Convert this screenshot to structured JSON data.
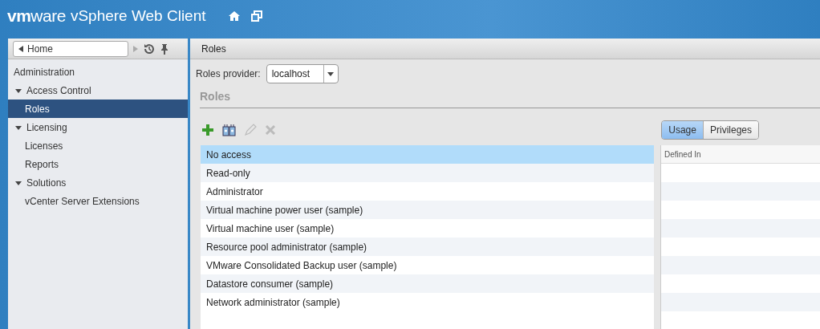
{
  "header": {
    "logo": "**vm**ware",
    "title": "vSphere Web Client"
  },
  "nav": {
    "back_label": "Home"
  },
  "sidebar": {
    "heading": "Administration",
    "items": [
      {
        "label": "Access Control",
        "kind": "group",
        "expanded": true,
        "selected": false
      },
      {
        "label": "Roles",
        "kind": "item",
        "selected": true
      },
      {
        "label": "Licensing",
        "kind": "group",
        "expanded": true,
        "selected": false
      },
      {
        "label": "Licenses",
        "kind": "item",
        "selected": false
      },
      {
        "label": "Reports",
        "kind": "item",
        "selected": false
      },
      {
        "label": "Solutions",
        "kind": "group",
        "expanded": true,
        "selected": false
      },
      {
        "label": "vCenter Server Extensions",
        "kind": "item",
        "selected": false
      }
    ]
  },
  "main": {
    "title": "Roles",
    "provider_label": "Roles provider:",
    "provider_value": "localhost",
    "section_title": "Roles",
    "toolbar": [
      {
        "kind": "add",
        "disabled": false
      },
      {
        "kind": "clone",
        "disabled": false
      },
      {
        "kind": "edit",
        "disabled": true
      },
      {
        "kind": "delete",
        "disabled": true
      }
    ],
    "view_tabs": [
      {
        "label": "Usage",
        "selected": true
      },
      {
        "label": "Privileges",
        "selected": false
      }
    ],
    "roles": [
      {
        "name": "No access",
        "selected": true
      },
      {
        "name": "Read-only",
        "selected": false
      },
      {
        "name": "Administrator",
        "selected": false
      },
      {
        "name": "Virtual machine power user (sample)",
        "selected": false
      },
      {
        "name": "Virtual machine user (sample)",
        "selected": false
      },
      {
        "name": "Resource pool administrator (sample)",
        "selected": false
      },
      {
        "name": "VMware Consolidated Backup user (sample)",
        "selected": false
      },
      {
        "name": "Datastore consumer (sample)",
        "selected": false
      },
      {
        "name": "Network administrator (sample)",
        "selected": false
      }
    ],
    "usage_column": "Defined In"
  }
}
